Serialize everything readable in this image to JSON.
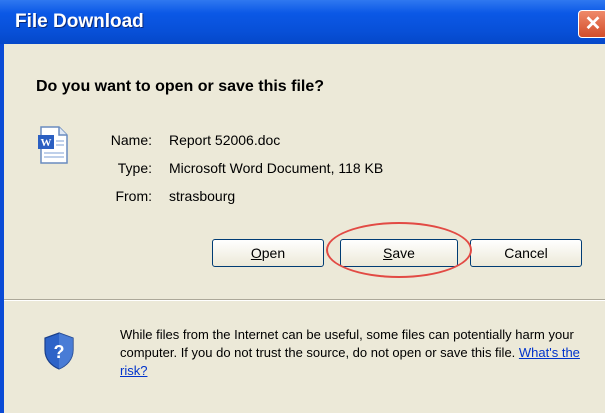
{
  "window": {
    "title": "File Download",
    "close_symbol": "✕"
  },
  "question": "Do you want to open or save this file?",
  "file": {
    "icon": "word-document-icon",
    "name_label": "Name:",
    "name_value": "Report 52006.doc",
    "type_label": "Type:",
    "type_value": "Microsoft Word Document, 118 KB",
    "from_label": "From:",
    "from_value": "strasbourg"
  },
  "buttons": {
    "open_label_prefix": "O",
    "open_label_rest": "pen",
    "save_label_prefix": "S",
    "save_label_rest": "ave",
    "cancel_label": "Cancel"
  },
  "warning": {
    "icon": "shield-question-icon",
    "text": "While files from the Internet can be useful, some files can potentially harm your computer. If you do not trust the source, do not open or save this file. ",
    "link": "What's the risk?"
  },
  "colors": {
    "title_bar": "#0b58e6",
    "dialog_bg": "#ece9d8",
    "highlight_circle": "#e24a44",
    "link": "#0033cc"
  }
}
